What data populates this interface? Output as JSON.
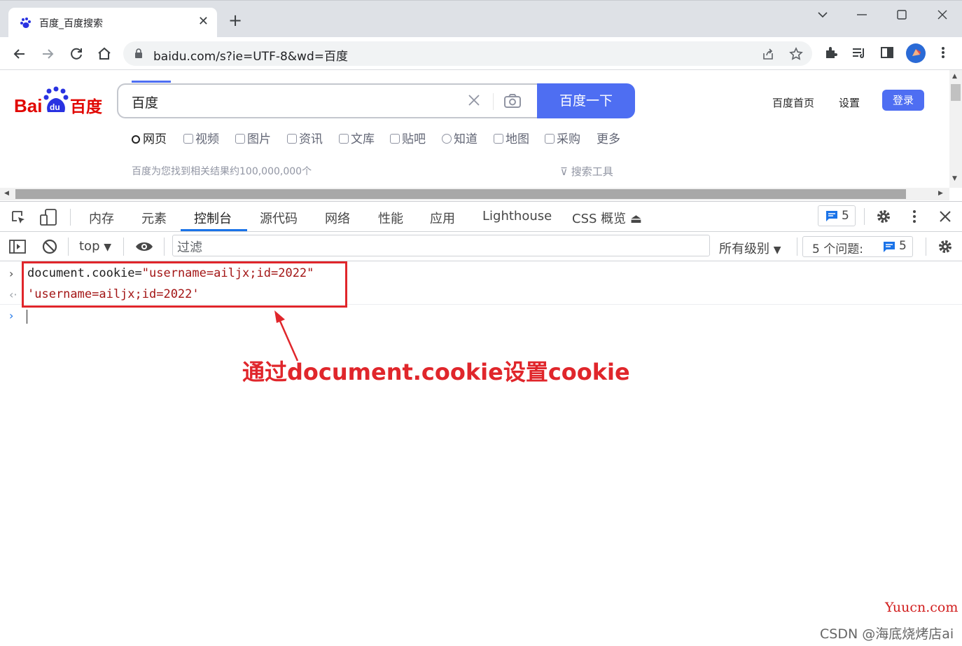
{
  "browser": {
    "tab_title": "百度_百度搜索",
    "new_tab_label": "+",
    "url": "baidu.com/s?ie=UTF-8&wd=百度"
  },
  "baidu": {
    "query": "百度",
    "search_button": "百度一下",
    "links": {
      "home": "百度首页",
      "settings": "设置",
      "login": "登录"
    },
    "nav_tabs": [
      "网页",
      "视频",
      "图片",
      "资讯",
      "文库",
      "贴吧",
      "知道",
      "地图",
      "采购",
      "更多"
    ],
    "result_count": "百度为您找到相关结果约100,000,000个",
    "search_tools": "搜索工具"
  },
  "devtools": {
    "tabs": [
      "内存",
      "元素",
      "控制台",
      "源代码",
      "网络",
      "性能",
      "应用",
      "Lighthouse",
      "CSS 概览"
    ],
    "active_tab": "控制台",
    "issues_count": "5",
    "context": "top",
    "filter_placeholder": "过滤",
    "levels": "所有级别",
    "issues_label": "5 个问题:",
    "issues_label_count": "5"
  },
  "console": {
    "input_line_code": "document.cookie=",
    "input_line_string": "\"username=ailjx;id=2022\"",
    "output_line": "'username=ailjx;id=2022'"
  },
  "annotation": "通过document.cookie设置cookie",
  "watermarks": {
    "site": "Yuucn.com",
    "author": "CSDN @海底烧烤店ai"
  },
  "colors": {
    "baidu_blue": "#4e6ef2",
    "devtools_blue": "#1a73e8",
    "annotation_red": "#e0262b",
    "console_string": "#a31515"
  }
}
